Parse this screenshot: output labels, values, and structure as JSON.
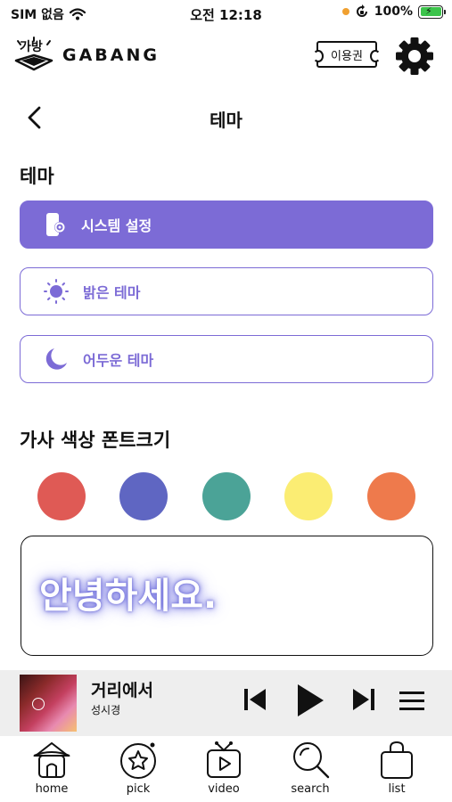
{
  "status_bar": {
    "carrier": "SIM 없음",
    "time": "오전 12:18",
    "battery": "100%"
  },
  "header": {
    "brand": "GABANG",
    "logo_text": "가방",
    "ticket_label": "이용권"
  },
  "page": {
    "title": "테마",
    "theme_section_title": "테마",
    "themes": [
      {
        "label": "시스템 설정",
        "icon": "phone-settings-icon",
        "selected": true
      },
      {
        "label": "밝은 테마",
        "icon": "sun-icon",
        "selected": false
      },
      {
        "label": "어두운 테마",
        "icon": "moon-icon",
        "selected": false
      }
    ],
    "lyrics_section_title": "가사 색상 폰트크기",
    "colors": [
      "#df5a55",
      "#5f66c2",
      "#4ba397",
      "#fbed73",
      "#ee7a4c"
    ],
    "preview_text": "안녕하세요."
  },
  "player": {
    "song_title": "거리에서",
    "artist": "성시경"
  },
  "tabs": [
    {
      "label": "home",
      "icon": "home-icon"
    },
    {
      "label": "pick",
      "icon": "star-icon"
    },
    {
      "label": "video",
      "icon": "video-icon"
    },
    {
      "label": "search",
      "icon": "search-icon"
    },
    {
      "label": "list",
      "icon": "bag-icon"
    }
  ],
  "accent_color": "#7c6bd6"
}
